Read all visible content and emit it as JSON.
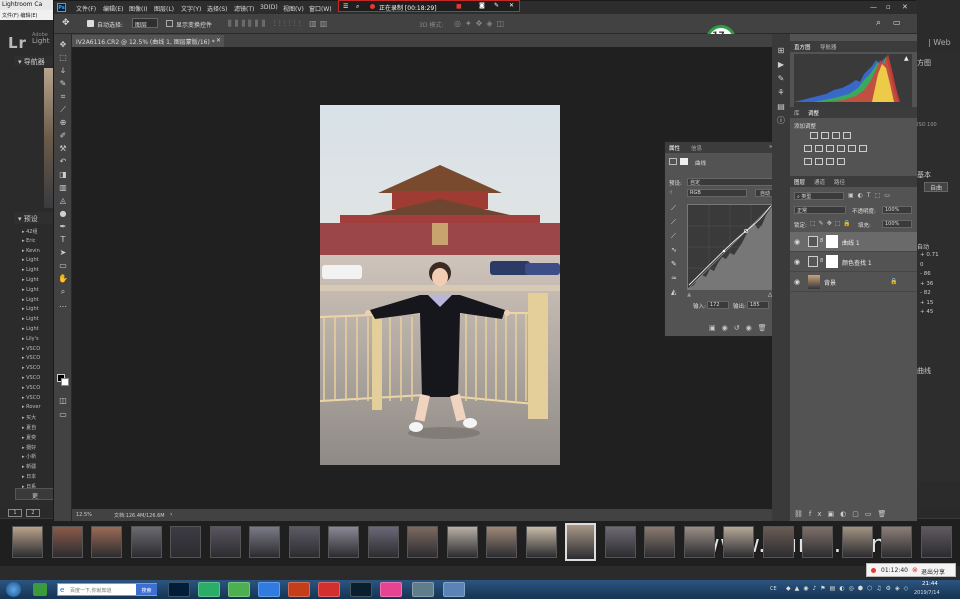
{
  "lightroom": {
    "title": "Lightroom Ca",
    "menus": [
      "文件(F)",
      "编辑(E)"
    ],
    "logo": "Lr",
    "brand_line1": "Adobe",
    "brand_line2": "Light",
    "navigator_label": "导航器",
    "presets_label": "预设",
    "presets": [
      "42组",
      "Eric",
      "Kevin",
      "Light",
      "Light",
      "Light",
      "Light",
      "Light",
      "Light",
      "Light",
      "Light",
      "Lily's",
      "VSCO",
      "VSCO",
      "VSCO",
      "VSCO",
      "VSCO",
      "VSCO",
      "Rover",
      "买大",
      "夏自",
      "夏奕",
      "摄好",
      "小新",
      "新疆",
      "日本",
      "日系"
    ],
    "bottom_button": "更",
    "right_web": "Web",
    "right_panel": {
      "label1": "方图",
      "label2": "基本",
      "btn": "自曲",
      "auto": "自动",
      "vals": [
        "+ 0.71",
        "0",
        "- 86",
        "+ 36",
        "- 82",
        "+ 15",
        "+ 45"
      ],
      "curve": "曲线",
      "iso": "ISO 100"
    }
  },
  "photoshop": {
    "menus": [
      "文件(F)",
      "编辑(E)",
      "图像(I)",
      "图层(L)",
      "文字(Y)",
      "选择(S)",
      "滤镜(T)",
      "3D(D)",
      "视图(V)",
      "窗口(W)"
    ],
    "options": {
      "auto_select": "自动选择:",
      "auto_select_value": "图层",
      "show_transform": "显示变换控件",
      "mode3d": "3D 模式:"
    },
    "document_tab": "IV2A6116.CR2 @ 12.5% (曲线 1, 图层蒙版/16) *",
    "status_zoom": "12.5%",
    "status_doc": "文档:126.4M/126.6M",
    "perf_badge": {
      "percent": "17",
      "percent_sign": "%",
      "temp": "48°C"
    }
  },
  "recording": {
    "label": "正在录制 [00:18:29]"
  },
  "properties": {
    "tab1": "属性",
    "tab2": "信息",
    "title": "曲线",
    "preset_label": "预设:",
    "preset_value": "自定",
    "channel_value": "RGB",
    "auto_button": "自动",
    "input_label": "输入:",
    "input_value": "172",
    "output_label": "输出:",
    "output_value": "185"
  },
  "panels": {
    "histogram_tab": "直方图",
    "navigator_tab": "导航器",
    "swatches_tab": "库",
    "adjust_tab": "调整",
    "add_adjustment": "添加调整",
    "layers_tab": "图层",
    "channels_tab": "通道",
    "paths_tab": "路径",
    "kind_label": "类型",
    "blend_mode": "正常",
    "opacity_label": "不透明度:",
    "opacity_value": "100%",
    "lock_label": "锁定:",
    "fill_label": "填充:",
    "fill_value": "100%",
    "layers": [
      {
        "name": "曲线 1"
      },
      {
        "name": "颜色查找 1"
      },
      {
        "name": "背景"
      }
    ]
  },
  "share": {
    "timer": "01:12:40",
    "exit_label": "退出分享"
  },
  "watermark": "www.hunls.com",
  "taskbar": {
    "search_placeholder": "百度一下,你就知道",
    "search_button": "搜索",
    "time": "21:44",
    "date": "2019/7/14",
    "ime": "CE"
  }
}
